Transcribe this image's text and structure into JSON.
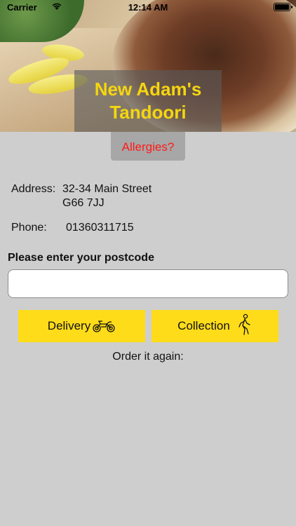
{
  "status_bar": {
    "carrier": "Carrier",
    "time": "12:14 AM"
  },
  "restaurant": {
    "name_line1": "New Adam's",
    "name_line2": "Tandoori",
    "allergies_label": "Allergies?"
  },
  "contact": {
    "address_label": "Address:",
    "address_line1": "32-34 Main Street",
    "address_line2": "G66 7JJ",
    "phone_label": "Phone:",
    "phone_value": "01360311715"
  },
  "postcode": {
    "label": "Please enter your postcode",
    "value": "",
    "placeholder": ""
  },
  "actions": {
    "delivery_label": "Delivery",
    "delivery_icon": "motorbike-icon",
    "collection_label": "Collection",
    "collection_icon": "walking-person-icon"
  },
  "order_again_label": "Order it again:",
  "colors": {
    "accent_yellow": "#ffdc1a",
    "title_yellow": "#f5d60f",
    "allergy_red": "#ff1a1a",
    "background": "#cecece"
  }
}
